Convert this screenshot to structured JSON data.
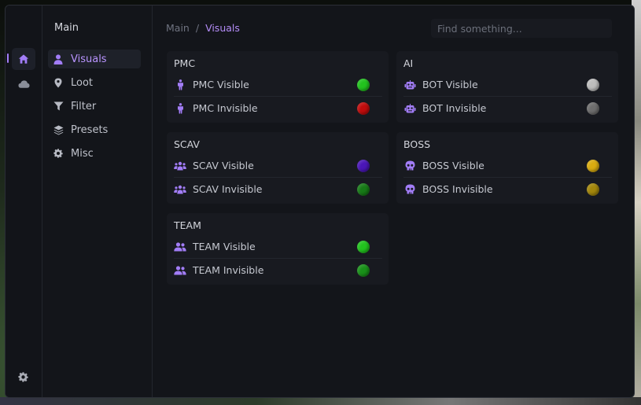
{
  "sidebar": {
    "title": "Main",
    "items": [
      {
        "label": "Visuals",
        "icon": "user-icon",
        "active": true
      },
      {
        "label": "Loot",
        "icon": "map-pin-icon",
        "active": false
      },
      {
        "label": "Filter",
        "icon": "filter-icon",
        "active": false
      },
      {
        "label": "Presets",
        "icon": "layers-icon",
        "active": false
      },
      {
        "label": "Misc",
        "icon": "gear-icon",
        "active": false
      }
    ]
  },
  "rail": {
    "items": [
      {
        "icon": "home-icon",
        "active": true
      },
      {
        "icon": "cloud-icon",
        "active": false
      }
    ],
    "bottom_icon": "settings-icon"
  },
  "breadcrumb": {
    "root": "Main",
    "separator": "/",
    "current": "Visuals"
  },
  "search": {
    "placeholder": "Find something..."
  },
  "colors": {
    "accent": "#a27df7",
    "pmc_visible": "#22c31e",
    "pmc_invisible": "#c00c0c",
    "bot_visible": "#bdbdbd",
    "bot_invisible": "#6e6e6e",
    "scav_visible": "#4a16b8",
    "scav_invisible": "#177a17",
    "boss_visible": "#d9ac10",
    "boss_invisible": "#a3870c",
    "team_visible": "#22c31e",
    "team_invisible": "#199119"
  },
  "groups": {
    "pmc": {
      "title": "PMC",
      "icon": "person-icon",
      "rows": [
        {
          "label": "PMC Visible",
          "color": "#22c31e"
        },
        {
          "label": "PMC Invisible",
          "color": "#c00c0c"
        }
      ]
    },
    "ai": {
      "title": "AI",
      "icon": "robot-icon",
      "rows": [
        {
          "label": "BOT Visible",
          "color": "#bdbdbd"
        },
        {
          "label": "BOT Invisible",
          "color": "#6e6e6e"
        }
      ]
    },
    "scav": {
      "title": "SCAV",
      "icon": "users-group-icon",
      "rows": [
        {
          "label": "SCAV Visible",
          "color": "#4a16b8"
        },
        {
          "label": "SCAV Invisible",
          "color": "#177a17"
        }
      ]
    },
    "boss": {
      "title": "BOSS",
      "icon": "skull-icon",
      "rows": [
        {
          "label": "BOSS Visible",
          "color": "#d9ac10"
        },
        {
          "label": "BOSS Invisible",
          "color": "#a3870c"
        }
      ]
    },
    "team": {
      "title": "TEAM",
      "icon": "user-friends-icon",
      "rows": [
        {
          "label": "TEAM Visible",
          "color": "#22c31e"
        },
        {
          "label": "TEAM Invisible",
          "color": "#199119"
        }
      ]
    }
  }
}
